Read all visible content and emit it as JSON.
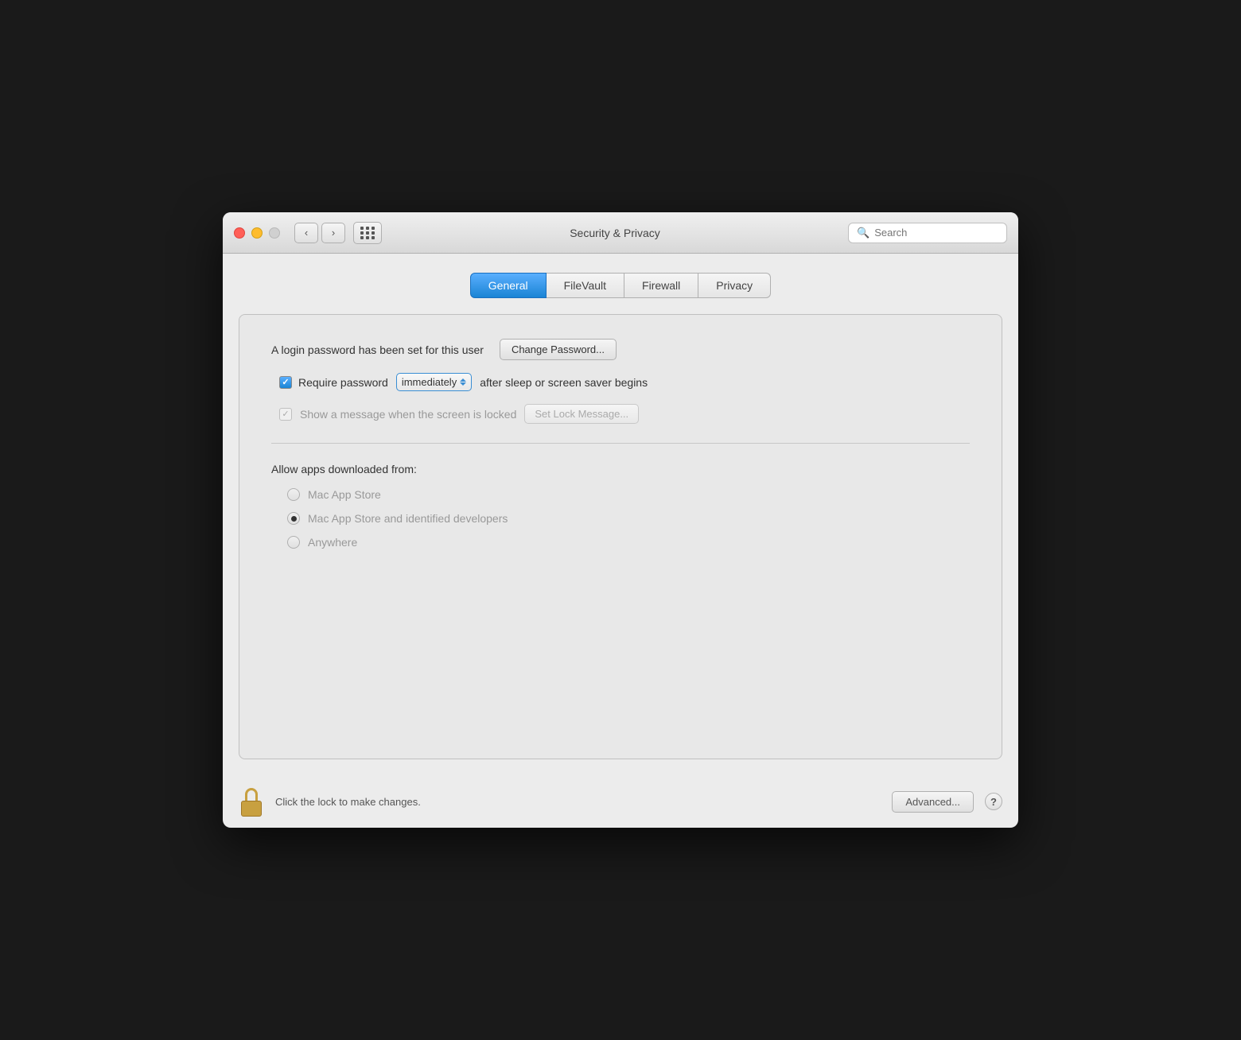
{
  "window": {
    "title": "Security & Privacy"
  },
  "titlebar": {
    "back_label": "‹",
    "forward_label": "›",
    "search_placeholder": "Search"
  },
  "tabs": [
    {
      "id": "general",
      "label": "General",
      "active": true
    },
    {
      "id": "filevault",
      "label": "FileVault",
      "active": false
    },
    {
      "id": "firewall",
      "label": "Firewall",
      "active": false
    },
    {
      "id": "privacy",
      "label": "Privacy",
      "active": false
    }
  ],
  "general": {
    "password_label": "A login password has been set for this user",
    "change_password_btn": "Change Password...",
    "require_password_label": "Require password",
    "require_password_dropdown": "immediately",
    "after_sleep_label": "after sleep or screen saver begins",
    "show_message_label": "Show a message when the screen is locked",
    "set_lock_message_btn": "Set Lock Message...",
    "allow_apps_label": "Allow apps downloaded from:",
    "radio_options": [
      {
        "id": "mac-app-store",
        "label": "Mac App Store",
        "selected": false
      },
      {
        "id": "mac-app-store-developers",
        "label": "Mac App Store and identified developers",
        "selected": true
      },
      {
        "id": "anywhere",
        "label": "Anywhere",
        "selected": false
      }
    ]
  },
  "bottom": {
    "lock_label": "Click the lock to make changes.",
    "advanced_btn": "Advanced...",
    "help_btn": "?"
  }
}
